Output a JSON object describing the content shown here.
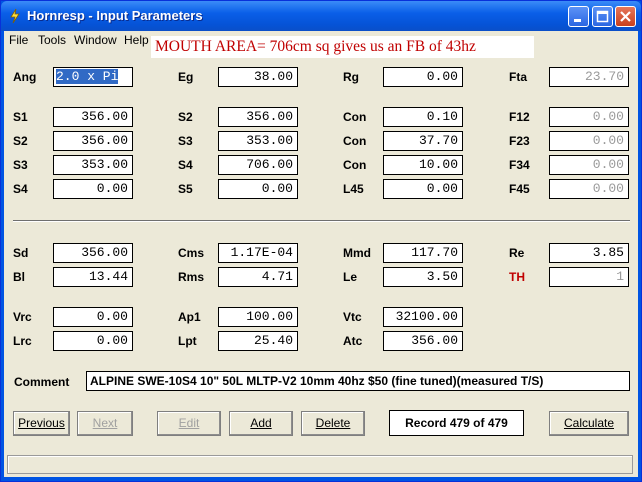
{
  "window": {
    "title": "Hornresp - Input Parameters"
  },
  "menu": [
    "File",
    "Tools",
    "Window",
    "Help"
  ],
  "note": "MOUTH AREA= 706cm sq gives us an FB of 43hz",
  "params": {
    "Ang": "2.0 x Pi",
    "Eg": "38.00",
    "Rg": "0.00",
    "Fta": "23.70",
    "S1": "356.00",
    "S2a": "356.00",
    "Con1": "0.10",
    "F12": "0.00",
    "S2": "356.00",
    "S3a": "353.00",
    "Con2": "37.70",
    "F23": "0.00",
    "S3": "353.00",
    "S4a": "706.00",
    "Con3": "10.00",
    "F34": "0.00",
    "S4": "0.00",
    "S5": "0.00",
    "L45": "0.00",
    "F45": "0.00",
    "Sd": "356.00",
    "Cms": "1.17E-04",
    "Mmd": "117.70",
    "Re": "3.85",
    "Bl": "13.44",
    "Rms": "4.71",
    "Le": "3.50",
    "TH": "1",
    "Vrc": "0.00",
    "Ap1": "100.00",
    "Vtc": "32100.00",
    "Lrc": "0.00",
    "Lpt": "25.40",
    "Atc": "356.00"
  },
  "labels": {
    "Ang": "Ang",
    "Eg": "Eg",
    "Rg": "Rg",
    "Fta": "Fta",
    "S1": "S1",
    "S2": "S2",
    "Con": "Con",
    "F12": "F12",
    "S3": "S3",
    "F23": "F23",
    "S4": "S4",
    "F34": "F34",
    "S5": "S5",
    "L45": "L45",
    "F45": "F45",
    "Sd": "Sd",
    "Cms": "Cms",
    "Mmd": "Mmd",
    "Re": "Re",
    "Bl": "Bl",
    "Rms": "Rms",
    "Le": "Le",
    "TH": "TH",
    "Vrc": "Vrc",
    "Ap1": "Ap1",
    "Vtc": "Vtc",
    "Lrc": "Lrc",
    "Lpt": "Lpt",
    "Atc": "Atc",
    "Comment": "Comment"
  },
  "comment": "ALPINE SWE-10S4 10\" 50L MLTP-V2 10mm 40hz $50 (fine tuned)(measured T/S)",
  "buttons": {
    "previous": "Previous",
    "next": "Next",
    "edit": "Edit",
    "add": "Add",
    "delete": "Delete",
    "calculate": "Calculate"
  },
  "record": "Record 479 of 479"
}
